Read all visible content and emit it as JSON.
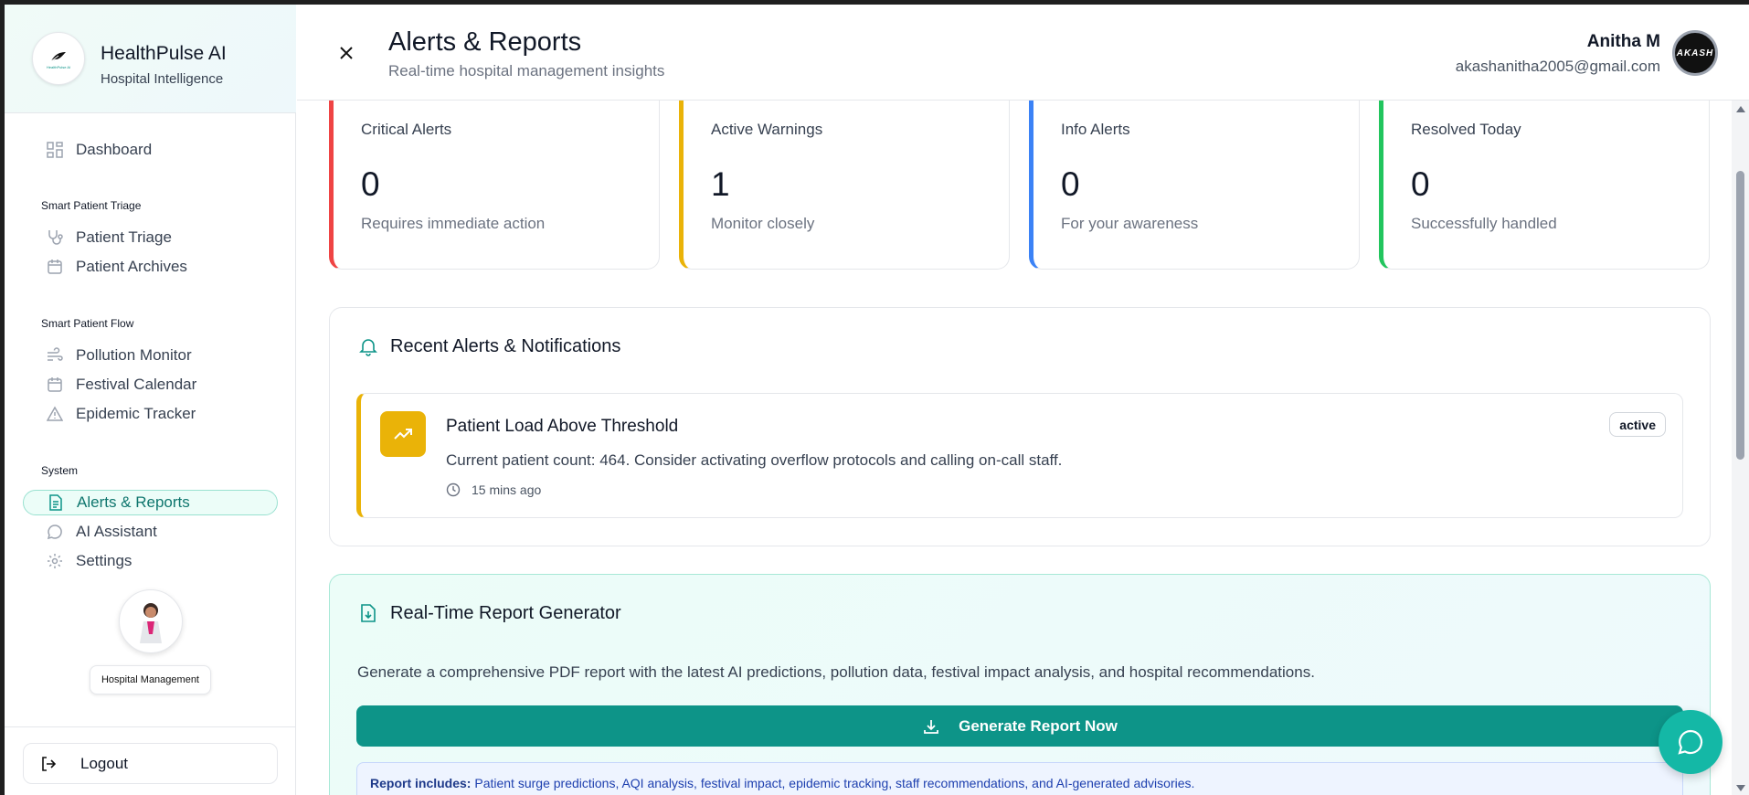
{
  "brand": {
    "title": "HealthPulse AI",
    "subtitle": "Hospital Intelligence",
    "logo_text": "HealthPulse AI"
  },
  "sidebar": {
    "dashboard": "Dashboard",
    "sections": [
      {
        "title": "Smart Patient Triage",
        "items": [
          "Patient Triage",
          "Patient Archives"
        ]
      },
      {
        "title": "Smart Patient Flow",
        "items": [
          "Pollution Monitor",
          "Festival Calendar",
          "Epidemic Tracker"
        ]
      },
      {
        "title": "System",
        "items": [
          "Alerts & Reports",
          "AI Assistant",
          "Settings"
        ]
      }
    ],
    "active_item": "Alerts & Reports",
    "mascot_label": "Hospital Management",
    "logout": "Logout"
  },
  "header": {
    "title": "Alerts & Reports",
    "subtitle": "Real-time hospital management insights",
    "user_name": "Anitha M",
    "user_email": "akashanitha2005@gmail.com",
    "avatar_text": "AKASH"
  },
  "stats": [
    {
      "title": "Critical Alerts",
      "value": "0",
      "desc": "Requires immediate action",
      "color": "#ef4444"
    },
    {
      "title": "Active Warnings",
      "value": "1",
      "desc": "Monitor closely",
      "color": "#eab308"
    },
    {
      "title": "Info Alerts",
      "value": "0",
      "desc": "For your awareness",
      "color": "#3b82f6"
    },
    {
      "title": "Resolved Today",
      "value": "0",
      "desc": "Successfully handled",
      "color": "#22c55e"
    }
  ],
  "alerts_panel": {
    "title": "Recent Alerts & Notifications",
    "items": [
      {
        "title": "Patient Load Above Threshold",
        "desc": "Current patient count: 464. Consider activating overflow protocols and calling on-call staff.",
        "time": "15 mins ago",
        "status": "active"
      }
    ]
  },
  "report_panel": {
    "title": "Real-Time Report Generator",
    "desc": "Generate a comprehensive PDF report with the latest AI predictions, pollution data, festival impact analysis, and hospital recommendations.",
    "button": "Generate Report Now",
    "includes_label": "Report includes:",
    "includes_text": "Patient surge predictions, AQI analysis, festival impact, epidemic tracking, staff recommendations, and AI-generated advisories."
  },
  "colors": {
    "accent": "#0d9488",
    "warning": "#eab308",
    "chat_fab": "#14b8a6"
  }
}
